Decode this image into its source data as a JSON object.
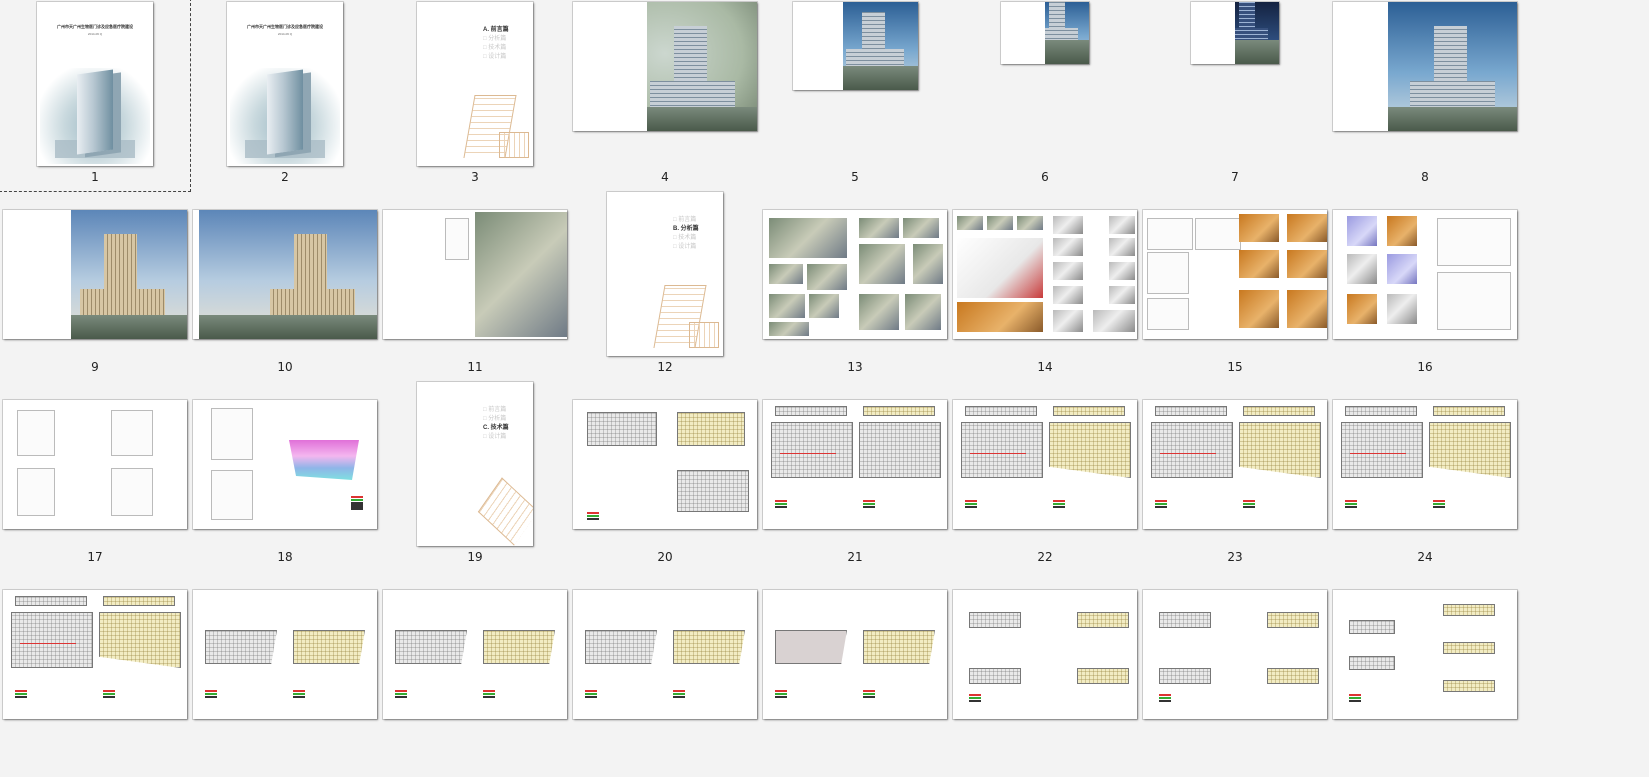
{
  "app": {
    "view": "slide-sorter",
    "selected_slide": 1
  },
  "slides": [
    {
      "number": "1",
      "kind": "cover",
      "title_text": "广州市天广州生物医门诊及应急医疗院建设",
      "subtitle_text": "2014-06 Q"
    },
    {
      "number": "2",
      "kind": "cover",
      "title_text": "广州市天广州生物医门诊及应急医疗院建设",
      "subtitle_text": "2014-06 Q"
    },
    {
      "number": "3",
      "kind": "section",
      "menu": [
        "A. 前言篇",
        "B. 分析篇",
        "C. 技术篇",
        "D. 设计篇"
      ],
      "active": 0
    },
    {
      "number": "4",
      "kind": "render",
      "variant": "aerial"
    },
    {
      "number": "5",
      "kind": "render",
      "variant": "day"
    },
    {
      "number": "6",
      "kind": "render",
      "variant": "day"
    },
    {
      "number": "7",
      "kind": "render",
      "variant": "night"
    },
    {
      "number": "8",
      "kind": "render",
      "variant": "day"
    },
    {
      "number": "9",
      "kind": "render",
      "variant": "warm"
    },
    {
      "number": "10",
      "kind": "render",
      "variant": "warm"
    },
    {
      "number": "11",
      "kind": "siteplan"
    },
    {
      "number": "12",
      "kind": "section",
      "menu": [
        "A. 前言篇",
        "B. 分析篇",
        "C. 技术篇",
        "D. 设计篇"
      ],
      "active": 1
    },
    {
      "number": "13",
      "kind": "photos"
    },
    {
      "number": "14",
      "kind": "analysis"
    },
    {
      "number": "15",
      "kind": "diagrams"
    },
    {
      "number": "16",
      "kind": "massing"
    },
    {
      "number": "17",
      "kind": "plans4"
    },
    {
      "number": "18",
      "kind": "chart"
    },
    {
      "number": "19",
      "kind": "section",
      "menu": [
        "A. 前言篇",
        "B. 分析篇",
        "C. 技术篇",
        "D. 设计篇"
      ],
      "active": 2
    },
    {
      "number": "20",
      "kind": "plans3"
    },
    {
      "number": "21",
      "kind": "plans2"
    },
    {
      "number": "22",
      "kind": "plans2y"
    },
    {
      "number": "23",
      "kind": "plans2y"
    },
    {
      "number": "24",
      "kind": "plans2y"
    },
    {
      "number": "",
      "kind": "plans2yb"
    },
    {
      "number": "",
      "kind": "wide2"
    },
    {
      "number": "",
      "kind": "wide2"
    },
    {
      "number": "",
      "kind": "wide2"
    },
    {
      "number": "",
      "kind": "wide2r"
    },
    {
      "number": "",
      "kind": "strips4"
    },
    {
      "number": "",
      "kind": "strips4"
    },
    {
      "number": "",
      "kind": "strips5"
    }
  ],
  "colors": {
    "background": "#f3f3f3",
    "selection_border": "#444444"
  }
}
